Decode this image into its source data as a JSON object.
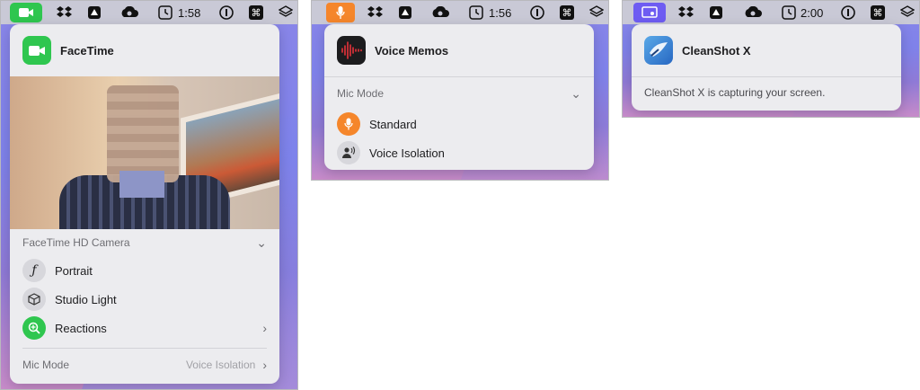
{
  "shot1": {
    "clock": "1:58",
    "app_title": "FaceTime",
    "camera_label": "FaceTime HD Camera",
    "rows": [
      {
        "label": "Portrait",
        "icon": "f-icon"
      },
      {
        "label": "Studio Light",
        "icon": "cube-icon"
      },
      {
        "label": "Reactions",
        "icon": "reactions-icon"
      }
    ],
    "mic_label": "Mic Mode",
    "mic_value": "Voice Isolation"
  },
  "shot2": {
    "clock": "1:56",
    "app_title": "Voice Memos",
    "section_label": "Mic Mode",
    "rows": [
      {
        "label": "Standard",
        "icon": "microphone-icon"
      },
      {
        "label": "Voice Isolation",
        "icon": "voice-isolation-icon"
      }
    ]
  },
  "shot3": {
    "clock": "2:00",
    "app_title": "CleanShot X",
    "message": "CleanShot X is capturing your screen."
  },
  "colors": {
    "facetime_green": "#2fc64f",
    "memo_orange": "#f5862b",
    "cleanshot_purple": "#6e5cf2"
  }
}
